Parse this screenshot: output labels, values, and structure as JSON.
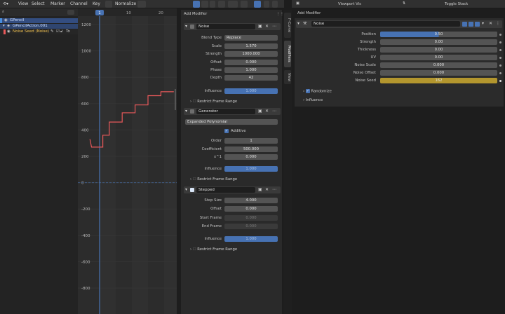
{
  "topbar": {
    "menus": [
      "View",
      "Select",
      "Marker",
      "Channel",
      "Key"
    ],
    "normalize": "Normalize"
  },
  "outliner": {
    "rows": [
      {
        "label": "GPencil",
        "level": 0,
        "color": "#4a8fdf"
      },
      {
        "label": "GPencilAction.001",
        "level": 1,
        "color": "#4a8fdf"
      },
      {
        "label": "Noise Seed (Noise)",
        "level": 2,
        "color": "#e3b03c",
        "suffix": "To"
      }
    ]
  },
  "graph": {
    "frame_ticks": [
      "1",
      "10",
      "20"
    ],
    "y_ticks": [
      "1200",
      "1000",
      "800",
      "600",
      "400",
      "200",
      "0",
      "-200",
      "-400",
      "-600",
      "-800"
    ],
    "curve_color": "#e8585a",
    "cursor_color": "#4772b3"
  },
  "chart_data": {
    "type": "line",
    "title": "",
    "xlabel": "",
    "ylabel": "",
    "ylim": [
      -900,
      1250
    ],
    "series": [
      {
        "points": [
          [
            -2,
            330
          ],
          [
            -1.5,
            270
          ],
          [
            2,
            270
          ],
          [
            2,
            360
          ],
          [
            4,
            360
          ],
          [
            4,
            460
          ],
          [
            8,
            460
          ],
          [
            8,
            530
          ],
          [
            12,
            530
          ],
          [
            12,
            590
          ],
          [
            16,
            590
          ],
          [
            16,
            660
          ],
          [
            20,
            660
          ],
          [
            20,
            690
          ],
          [
            24,
            690
          ]
        ]
      }
    ],
    "grid": true
  },
  "modifiers_panel": {
    "add_modifier": "Add Modifier",
    "noise": {
      "name": "Noise",
      "blend_type_label": "Blend Type",
      "blend_type": "Replace",
      "fields": [
        {
          "label": "Scale",
          "value": "1.570"
        },
        {
          "label": "Strength",
          "value": "1000.000"
        },
        {
          "label": "Offset",
          "value": "0.000"
        },
        {
          "label": "Phase",
          "value": "1.000"
        },
        {
          "label": "Depth",
          "value": "42"
        }
      ],
      "influence_label": "Influence",
      "influence_value": "1.000",
      "restrict": "Restrict Frame Range"
    },
    "generator": {
      "name": "Generator",
      "mode": "Expanded Polynomial",
      "additive": "Additive",
      "order_label": "Order",
      "order": "1",
      "coefficient_label": "Coefficient",
      "coefficient": "500.000",
      "x1_label": "x^1",
      "x1": "0.000",
      "influence_label": "Influence",
      "influence_value": "1.000",
      "restrict": "Restrict Frame Range"
    },
    "stepped": {
      "name": "Stepped",
      "fields": [
        {
          "label": "Step Size",
          "value": "4.000",
          "dim": false
        },
        {
          "label": "Offset",
          "value": "0.000",
          "dim": false
        },
        {
          "label": "Start Frame",
          "value": "0.000",
          "dim": true
        },
        {
          "label": "End Frame",
          "value": "0.000",
          "dim": true
        }
      ],
      "influence_label": "Influence",
      "influence_value": "1.000",
      "restrict": "Restrict Frame Range"
    }
  },
  "side_tabs": [
    "F-Curve",
    "Modifiers",
    "View"
  ],
  "right": {
    "viewport_vis": "Viewport Vis",
    "toggle_stack": "Toggle Stack",
    "add_modifier": "Add Modifier",
    "noise_name": "Noise",
    "fields": [
      {
        "label": "Position",
        "value": "0.50",
        "fill": 0.5,
        "accent": "#4772b3"
      },
      {
        "label": "Strength",
        "value": "0.00"
      },
      {
        "label": "Thickness",
        "value": "0.00"
      },
      {
        "label": "UV",
        "value": "0.00"
      },
      {
        "label": "Noise Scale",
        "value": "0.000"
      },
      {
        "label": "Noise Offset",
        "value": "0.000"
      },
      {
        "label": "Noise Seed",
        "value": "162",
        "accent": "#b3962e"
      }
    ],
    "randomize": "Randomize",
    "influence": "Influence"
  }
}
